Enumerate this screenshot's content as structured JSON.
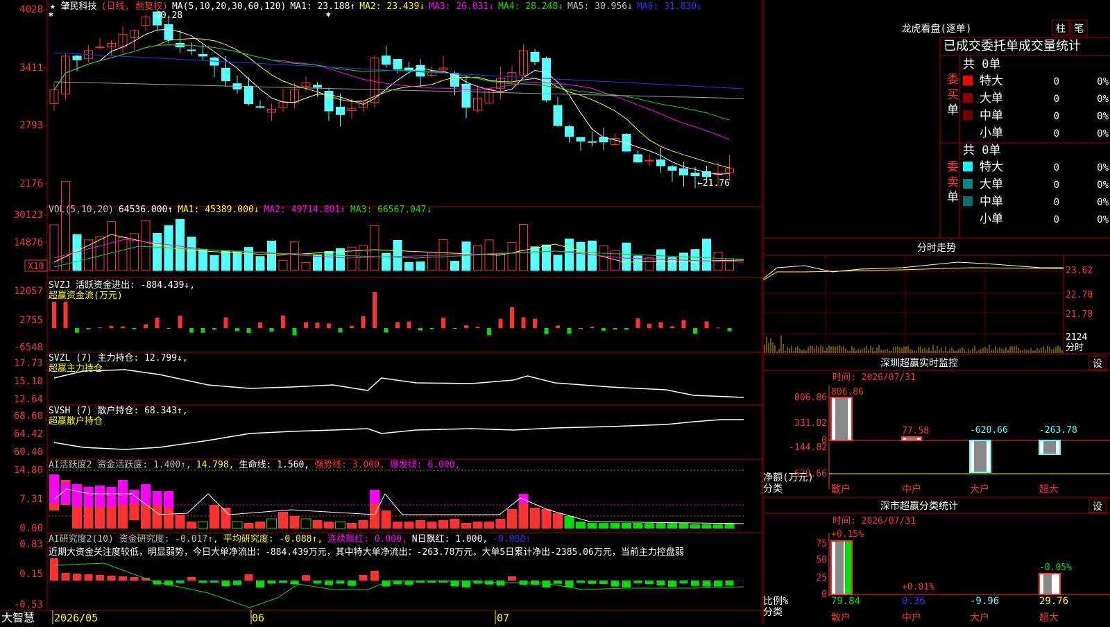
{
  "colors": {
    "up": "#ff3232",
    "down": "#54ffff",
    "grid": "#b00000",
    "white": "#ffffff",
    "yellow": "#ffff00",
    "magenta": "#ff00ff",
    "green": "#00e000",
    "blue": "#3030ff",
    "grey": "#a0a0a0",
    "gold": "#d4a800"
  },
  "stock": {
    "name": "★ 肇民科技",
    "mode": "(日线, 前复权)",
    "star_mark": "✱"
  },
  "price_panel": {
    "ticks": [
      "4028",
      "3411",
      "2793",
      "2176"
    ],
    "ma_label": "MA(5,10,20,30,60,120)",
    "ma_items": [
      {
        "t": "MA1: 23.188↑",
        "c": "#ffffff"
      },
      {
        "t": "MA2: 23.439↓",
        "c": "#ffff00"
      },
      {
        "t": "MA3: 26.031↓",
        "c": "#ff00ff"
      },
      {
        "t": "MA4: 28.248↓",
        "c": "#00e000"
      },
      {
        "t": "MA5: 30.956↓",
        "c": "#c0c0c0"
      },
      {
        "t": "MA6: 31.830↓",
        "c": "#3030ff"
      }
    ],
    "high_label": "40.28",
    "low_label": "←21.76"
  },
  "vol_panel": {
    "ticks": [
      "30123",
      "14876"
    ],
    "unit": "X10",
    "items": [
      {
        "t": "VOL(5,10,20)",
        "c": "#c0c0c0"
      },
      {
        "t": "64536.000↑",
        "c": "#ffffff"
      },
      {
        "t": "MA1: 45389.000↓",
        "c": "#ffff00"
      },
      {
        "t": "MA2: 49714.801↑",
        "c": "#ff00ff"
      },
      {
        "t": "MA3: 66567.047↓",
        "c": "#00e000"
      }
    ]
  },
  "svzj_panel": {
    "ticks": [
      "12057",
      "2755",
      "-6548"
    ],
    "line1": "SVZJ  活跃资金进出: -884.439↓,",
    "line2": "超赢资金流(万元)"
  },
  "svzl_panel": {
    "ticks": [
      "17.73",
      "15.18",
      "12.64"
    ],
    "line1": "SVZL (7) 主力持仓: 12.799↓,",
    "line2": "超赢主力持仓"
  },
  "svsh_panel": {
    "ticks": [
      "68.60",
      "64.42",
      "60.40"
    ],
    "line1": "SVSH (7) 散户持仓: 68.343↑,",
    "line2": "超赢散户持仓"
  },
  "ai1_panel": {
    "ticks": [
      "14.80",
      "7.31",
      "0.00"
    ],
    "items": [
      {
        "t": "AI活跃度2 资金活跃度: 1.400↑,",
        "c": "#c0c0c0"
      },
      {
        "t": "14.798,",
        "c": "#ffff00"
      },
      {
        "t": "生命线: 1.560,",
        "c": "#ffffff"
      },
      {
        "t": "强势线: 3.000,",
        "c": "#ff3232"
      },
      {
        "t": "爆发线: 6.000,",
        "c": "#ff00ff"
      }
    ]
  },
  "ai2_panel": {
    "ticks": [
      "0.83",
      "0.15",
      "-0.53"
    ],
    "items": [
      {
        "t": "AI研究度2(10) 资金研究度: -0.017↑,",
        "c": "#c0c0c0"
      },
      {
        "t": "平均研究度: -0.088↑,",
        "c": "#ffff00"
      },
      {
        "t": "连续飘红: 0.000,",
        "c": "#ff00ff"
      },
      {
        "t": "N日飘红: 1.000,",
        "c": "#ffffff"
      },
      {
        "t": "-0.088↑",
        "c": "#3030ff"
      }
    ],
    "comment": "近期大资金关注度较低，明显弱势，今日大单净流出：-884.439万元，其中特大单净流出：-263.78万元，大单5日累计净出-2385.06万元，当前主力控盘弱"
  },
  "xaxis": {
    "app": "大智慧",
    "labels": [
      "2026/05",
      "06",
      "07"
    ]
  },
  "right": {
    "lhb_title": "龙虎看盘(逐单)",
    "btn1": "柱",
    "btn2": "笔",
    "stat_title": "已成交委托单成交量统计",
    "buy_label": "委买单",
    "sell_label": "委卖单",
    "buy_total": "共 0单",
    "sell_total": "共 0单",
    "buy_rows": [
      {
        "n": "特大",
        "v": "0",
        "p": "0%",
        "c": "#ff0000"
      },
      {
        "n": "大单",
        "v": "0",
        "p": "0%",
        "c": "#900000"
      },
      {
        "n": "中单",
        "v": "0",
        "p": "0%",
        "c": "#700000"
      },
      {
        "n": "小单",
        "v": "0",
        "p": "0%",
        "c": ""
      }
    ],
    "sell_rows": [
      {
        "n": "特大",
        "v": "0",
        "p": "0%",
        "c": "#00ffff"
      },
      {
        "n": "大单",
        "v": "0",
        "p": "0%",
        "c": "#008888"
      },
      {
        "n": "中单",
        "v": "0",
        "p": "0%",
        "c": "#007070"
      },
      {
        "n": "小单",
        "v": "0",
        "p": "0%",
        "c": ""
      }
    ],
    "fs_title": "分时走势",
    "fs_ticks": [
      "23.62",
      "22.70",
      "21.78",
      "2124"
    ],
    "fs_unit": "分时",
    "sz_title": "深圳超赢实时监控",
    "sz_btn": "设",
    "sz_time": "时间: 2026/07/31",
    "sz_ticks": [
      "806.86",
      "331.02",
      "0",
      "-144.82",
      "-620.66"
    ],
    "sz_values": [
      {
        "l": "806.86",
        "c": "#ff3232"
      },
      {
        "l": "77.58",
        "c": "#ff3232"
      },
      {
        "l": "-620.66",
        "c": "#54ffff"
      },
      {
        "l": "-263.78",
        "c": "#54ffff"
      }
    ],
    "sz_ylabel1": "净额(万元)",
    "sz_ylabel2": "分类",
    "cats": [
      "散户",
      "中户",
      "大户",
      "超大"
    ],
    "sc_title": "深市超赢分类统计",
    "sc_btn": "设",
    "sc_time": "时间: 2026/07/31",
    "sc_ticks": [
      "75",
      "50",
      "25",
      "0"
    ],
    "sc_top": [
      {
        "l": "+0.15%",
        "c": "#ff3232"
      },
      {
        "l": "+0.01%",
        "c": "#ff3232"
      },
      {
        "l": "",
        "c": ""
      },
      {
        "l": "-0.05%",
        "c": "#00e000"
      }
    ],
    "sc_bottom": [
      {
        "l": "79.84",
        "c": "#00e000"
      },
      {
        "l": "0.36",
        "c": "#3030ff"
      },
      {
        "l": "-9.96",
        "c": "#54ffff"
      },
      {
        "l": "29.76",
        "c": "#ffff00"
      }
    ],
    "sc_ylabel1": "比例%",
    "sc_ylabel2": "分类"
  }
}
